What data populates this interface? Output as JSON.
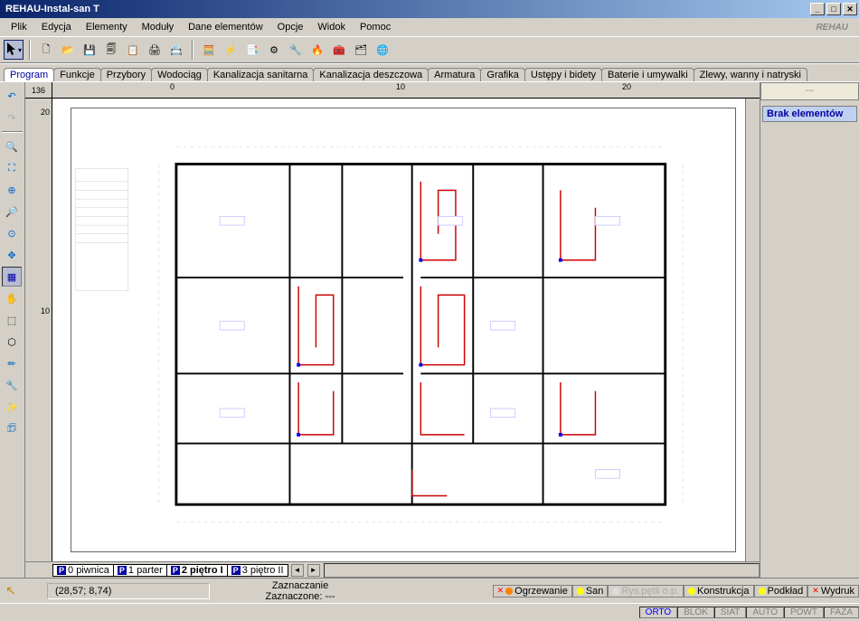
{
  "title": "REHAU-Instal-san T",
  "menus": [
    "Plik",
    "Edycja",
    "Elementy",
    "Moduły",
    "Dane elementów",
    "Opcje",
    "Widok",
    "Pomoc"
  ],
  "brand": "REHAU",
  "toolbar": {
    "cursor": "▸",
    "new": "🗋",
    "open": "📂",
    "save": "💾",
    "saveas": "🗐",
    "copy": "📋",
    "print": "🖨",
    "preview": "📇",
    "calc": "🧮",
    "flash": "⚡",
    "list": "📑",
    "opts": "⚙",
    "opts2": "🔧",
    "fire": "🔥",
    "tools": "🧰",
    "mod": "🗂",
    "web": "🌐"
  },
  "tabs": [
    "Program",
    "Funkcje",
    "Przybory",
    "Wodociąg",
    "Kanalizacja sanitarna",
    "Kanalizacja deszczowa",
    "Armatura",
    "Grafika",
    "Ustępy i bidety",
    "Baterie i umywalki",
    "Zlewy, wanny i natryski"
  ],
  "activeTab": 0,
  "leftTools": {
    "undo": "↶",
    "redo": "↷",
    "zoomIn": "🔍",
    "zoomArea": "⛶",
    "zoomPlus": "⊕",
    "zoomAll": "🔎",
    "zoomFit": "⊙",
    "center": "✥",
    "ortho": "▦",
    "pan": "✋",
    "selRect": "⬚",
    "selPoly": "⬡",
    "measure": "✏",
    "pipe": "🔧",
    "explode": "✨",
    "layers": "🗊"
  },
  "ruler": {
    "corner": "136",
    "h": [
      "0",
      "10",
      "20"
    ],
    "v": [
      "20",
      "10"
    ]
  },
  "rightPanel": {
    "header": "---",
    "tab": "Brak elementów"
  },
  "sheets": [
    {
      "p": "P",
      "name": "0 piwnica"
    },
    {
      "p": "P",
      "name": "1 parter"
    },
    {
      "p": "P",
      "name": "2 piętro I"
    },
    {
      "p": "P",
      "name": "3 piętro II"
    }
  ],
  "activeSheet": 2,
  "legend": [
    {
      "c": "#ff8000",
      "t": "Ogrzewanie",
      "x": "✕"
    },
    {
      "c": "#ffff00",
      "t": "San",
      "x": ""
    },
    {
      "c": "#c0c0c0",
      "t": "Rys.pętli o.p.",
      "x": ""
    },
    {
      "c": "#ffff00",
      "t": "Konstrukcja",
      "x": ""
    },
    {
      "c": "#ffff00",
      "t": "Podkład",
      "x": ""
    },
    {
      "c": "#c0c0c0",
      "t": "Wydruk",
      "x": "✕"
    }
  ],
  "modes": [
    {
      "t": "ORTO",
      "on": true
    },
    {
      "t": "BLOK",
      "on": false
    },
    {
      "t": "SIAT",
      "on": false
    },
    {
      "t": "AUTO",
      "on": false
    },
    {
      "t": "POWT",
      "on": false
    },
    {
      "t": "FAZA",
      "on": false
    }
  ],
  "info": {
    "coords": "(28,57; 8,74)",
    "mode": "Zaznaczanie",
    "sel": "Zaznaczone: ---"
  }
}
